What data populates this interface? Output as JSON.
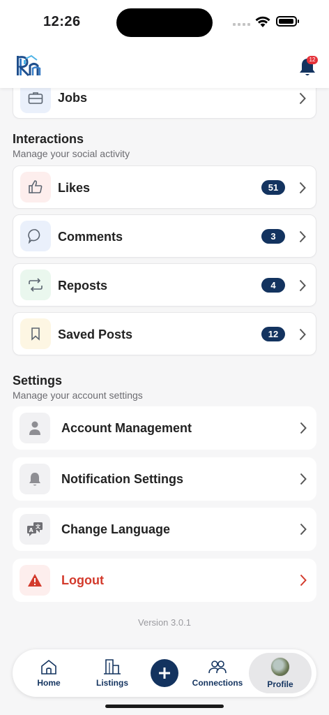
{
  "status_bar": {
    "time": "12:26"
  },
  "header": {
    "notification_count": "12"
  },
  "top_card": {
    "label": "Jobs"
  },
  "interactions": {
    "title": "Interactions",
    "subtitle": "Manage your social activity",
    "items": [
      {
        "label": "Likes",
        "count": "51",
        "icon": "thumbs-up-icon"
      },
      {
        "label": "Comments",
        "count": "3",
        "icon": "comment-icon"
      },
      {
        "label": "Reposts",
        "count": "4",
        "icon": "repost-icon"
      },
      {
        "label": "Saved Posts",
        "count": "12",
        "icon": "bookmark-icon"
      }
    ]
  },
  "settings": {
    "title": "Settings",
    "subtitle": "Manage your account settings",
    "items": [
      {
        "label": "Account Management",
        "icon": "person-icon"
      },
      {
        "label": "Notification Settings",
        "icon": "bell-icon"
      },
      {
        "label": "Change Language",
        "icon": "translate-icon"
      },
      {
        "label": "Logout",
        "icon": "warning-icon"
      }
    ]
  },
  "version": "Version 3.0.1",
  "tabbar": {
    "home": "Home",
    "listings": "Listings",
    "connections": "Connections",
    "profile": "Profile"
  },
  "colors": {
    "accent": "#13335f",
    "logout": "#d33a2c",
    "badge": "#e5323a"
  }
}
